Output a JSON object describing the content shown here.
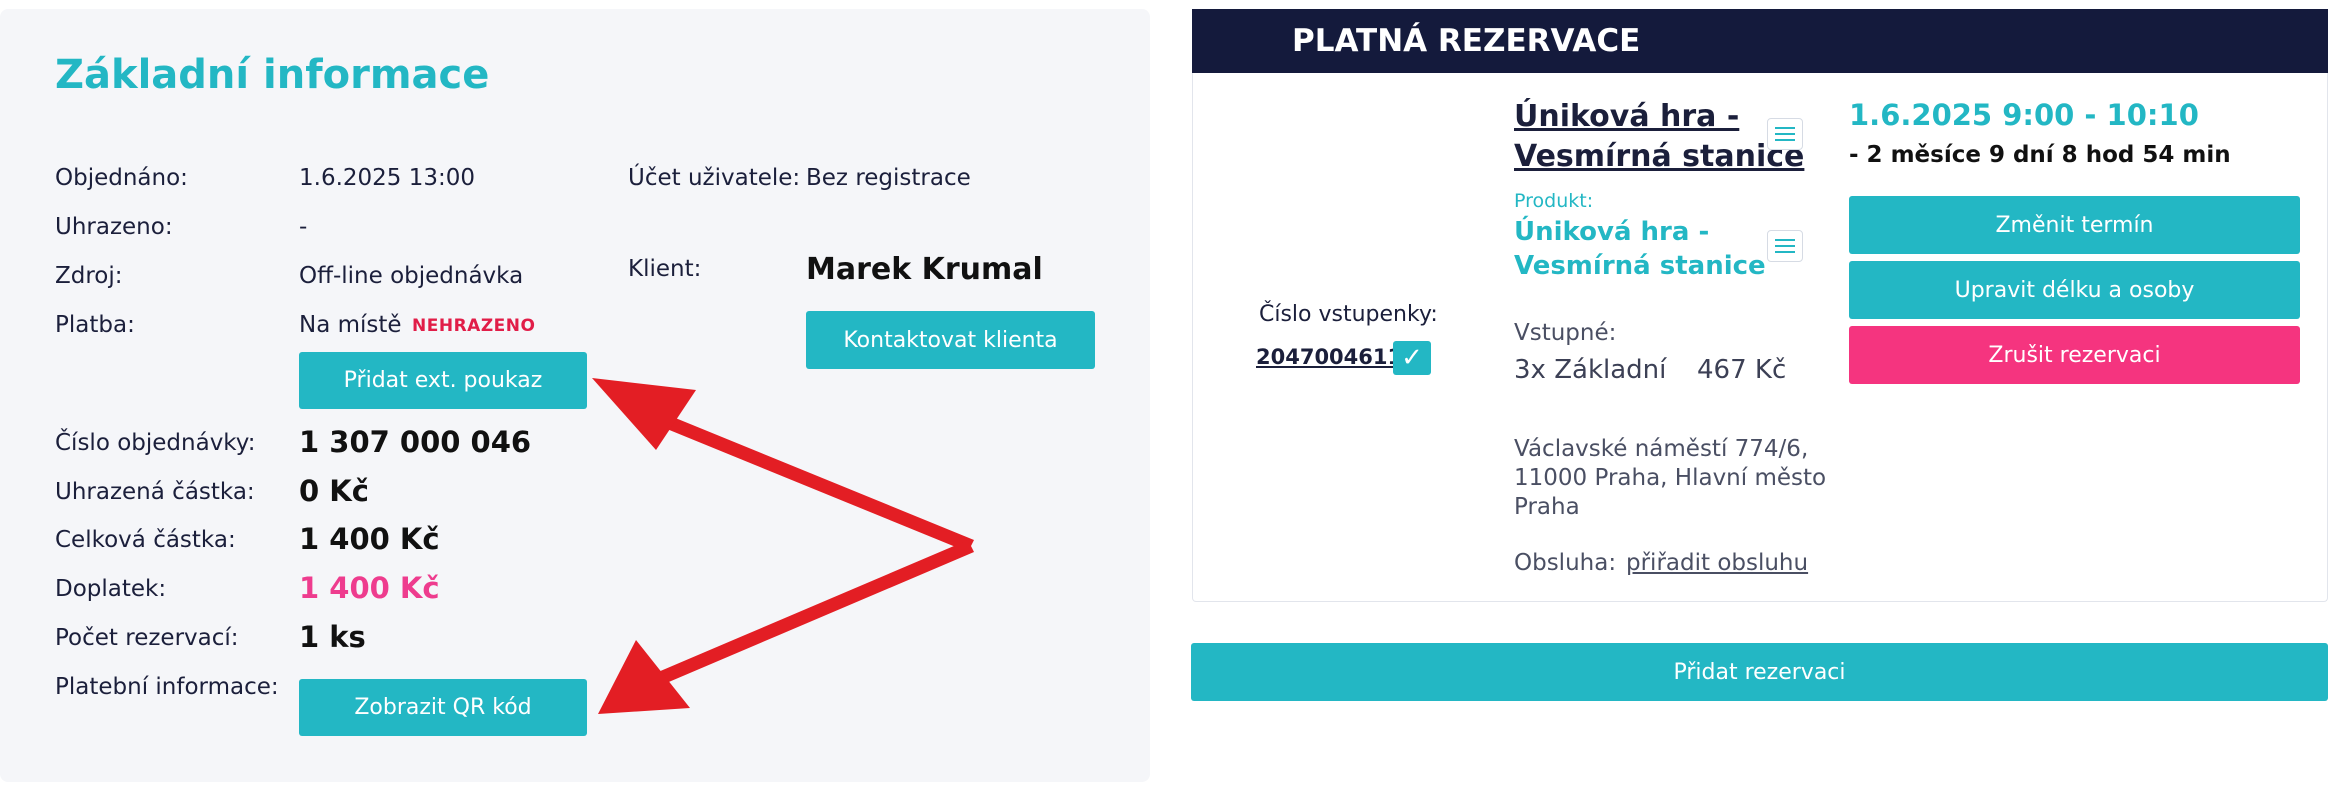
{
  "basic_info": {
    "title": "Základní informace",
    "ordered_label": "Objednáno:",
    "ordered_value": "1.6.2025 13:00",
    "paid_label": "Uhrazeno:",
    "paid_value": "-",
    "source_label": "Zdroj:",
    "source_value": "Off-line objednávka",
    "payment_label": "Platba:",
    "payment_value": "Na místě",
    "payment_status": "NEHRAZENO",
    "add_voucher_button": "Přidat ext. poukaz",
    "order_number_label": "Číslo objednávky:",
    "order_number_value": "1 307 000 046",
    "paid_amount_label": "Uhrazená částka:",
    "paid_amount_value": "0 Kč",
    "total_amount_label": "Celková částka:",
    "total_amount_value": "1 400 Kč",
    "surcharge_label": "Doplatek:",
    "surcharge_value": "1 400 Kč",
    "reservation_count_label": "Počet rezervací:",
    "reservation_count_value": "1 ks",
    "payment_info_label": "Platební informace:",
    "qr_button": "Zobrazit QR kód",
    "user_account_label": "Účet uživatele:",
    "user_account_value": "Bez registrace",
    "client_label": "Klient:",
    "client_value": "Marek Krumal",
    "contact_client_button": "Kontaktovat klienta"
  },
  "reservation": {
    "header": "PLATNÁ REZERVACE",
    "ticket_number_label": "Číslo vstupenky:",
    "ticket_number_value": "2047004611",
    "ticket_check": "✓",
    "game_title_line1": "Úniková hra -",
    "game_title_line2": "Vesmírná stanice",
    "product_label": "Produkt:",
    "product_line1": "Úniková hra -",
    "product_line2": "Vesmírná stanice",
    "entry_label": "Vstupné:",
    "entry_type": "3x Základní",
    "entry_price": "467 Kč",
    "address_line1": "Václavské náměstí 774/6,",
    "address_line2": "11000 Praha, Hlavní město",
    "address_line3": "Praha",
    "staff_label": "Obsluha:",
    "staff_link": "přiřadit obsluhu",
    "datetime": "1.6.2025 9:00 - 10:10",
    "countdown": "- 2 měsíce 9 dní 8 hod 54 min",
    "change_date_button": "Změnit termín",
    "edit_length_button": "Upravit délku a osoby",
    "cancel_button": "Zrušit rezervaci",
    "add_reservation_button": "Přidat rezervaci"
  },
  "colors": {
    "teal": "#23b7c4",
    "pink": "#f5347f",
    "navy": "#141a3c",
    "arrow_red": "#e31e24"
  },
  "icons": [
    "menu-icon",
    "check-icon",
    "arrow-annotation"
  ]
}
